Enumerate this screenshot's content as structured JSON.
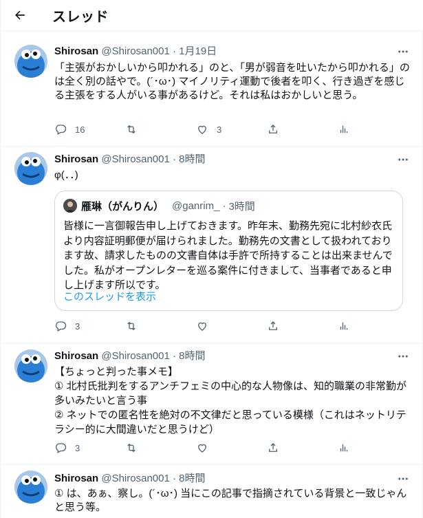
{
  "header": {
    "title": "スレッド"
  },
  "icons": {
    "back": "arrow-left-icon",
    "more": "more-icon",
    "reply": "reply-icon",
    "retweet": "retweet-icon",
    "like": "like-icon",
    "share": "share-icon",
    "analytics": "analytics-icon"
  },
  "colors": {
    "accent": "#1d9bf0",
    "secondary_text": "#536471",
    "avatar_blue": "#2a7fd4"
  },
  "tweets": [
    {
      "name": "Shirosan",
      "handle": "@Shirosan001",
      "separator": "·",
      "time": "1月19日",
      "text": "「主張がおかしいから叩かれる」のと、「男が弱音を吐いたから叩かれる」のは全く別の話やで。(´･ω･) マイノリティ運動で後者を叩く、行き過ぎを感じる主張をする人がいる事があるけど。それは私はおかしいと思う。",
      "reply_count": "16",
      "retweet_count": "",
      "like_count": "3"
    },
    {
      "name": "Shirosan",
      "handle": "@Shirosan001",
      "separator": "·",
      "time": "8時間",
      "text": "φ(．．)",
      "reply_count": "3",
      "retweet_count": "",
      "like_count": "",
      "quote": {
        "name": "雁琳（がんりん）",
        "handle": "@ganrim_",
        "separator": "·",
        "time": "3時間",
        "text": "皆様に一言御報告申し上げておきます。昨年末、勤務先宛に北村紗衣氏より内容証明郵便が届けられました。勤務先の文書として扱われております故、請求したものの文書自体は手許で所持することは出来ませんでした。私がオープンレターを巡る案件に付きまして、当事者であると申し上げます所以です。",
        "link": "このスレッドを表示"
      }
    },
    {
      "name": "Shirosan",
      "handle": "@Shirosan001",
      "separator": "·",
      "time": "8時間",
      "text": "【ちょっと判った事メモ】\n① 北村氏批判をするアンチフェミの中心的な人物像は、知的職業の非常勤が多いみたいと言う事\n② ネットでの匿名性を絶対の不文律だと思っている模様（これはネットリテラシー的に大間違いだと思うけど）",
      "reply_count": "3",
      "retweet_count": "",
      "like_count": ""
    },
    {
      "name": "Shirosan",
      "handle": "@Shirosan001",
      "separator": "·",
      "time": "8時間",
      "text": "① は、あぁ、察し。(´･ω･) 当にこの記事で指摘されている背景と一致じゃんと思う等。"
    }
  ]
}
